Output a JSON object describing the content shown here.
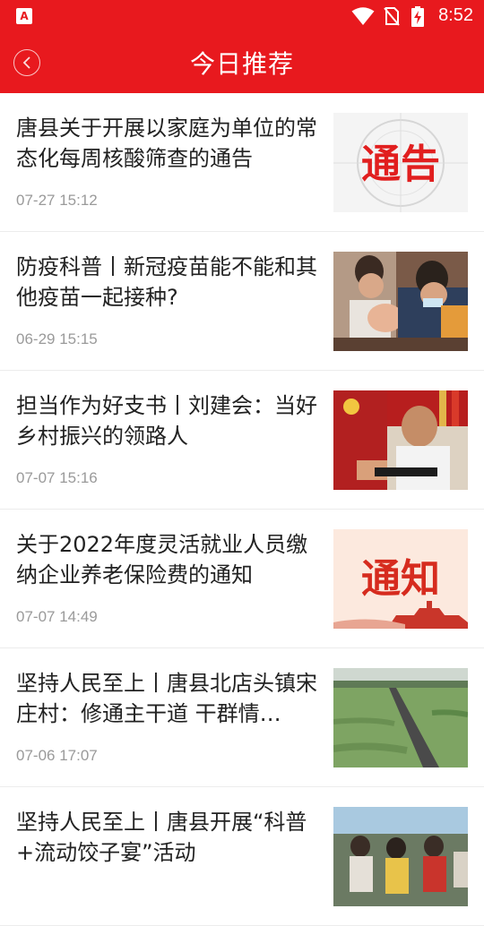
{
  "status_bar": {
    "time": "8:52",
    "app_icon_letter": "A",
    "icons": [
      "wifi-icon",
      "no-sim-icon",
      "battery-charging-icon"
    ]
  },
  "header": {
    "title": "今日推荐",
    "back_icon": "chevron-left-icon"
  },
  "feed": [
    {
      "title": "唐县关于开展以家庭为单位的常态化每周核酸筛查的通告",
      "date": "07-27 15:12",
      "thumb_text": "通告"
    },
    {
      "title": "防疫科普丨新冠疫苗能不能和其他疫苗一起接种?",
      "date": "06-29 15:15"
    },
    {
      "title": "担当作为好支书丨刘建会：当好乡村振兴的领路人",
      "date": "07-07 15:16"
    },
    {
      "title": "关于2022年度灵活就业人员缴纳企业养老保险费的通知",
      "date": "07-07 14:49",
      "thumb_text": "通知"
    },
    {
      "title": "坚持人民至上丨唐县北店头镇宋庄村：修通主干道 干群情…",
      "date": "07-06 17:07"
    },
    {
      "title": "坚持人民至上丨唐县开展“科普+流动饺子宴”活动",
      "date": ""
    }
  ],
  "colors": {
    "brand": "#e8191e",
    "title_text": "#222222",
    "date_text": "#9a9a9a"
  }
}
